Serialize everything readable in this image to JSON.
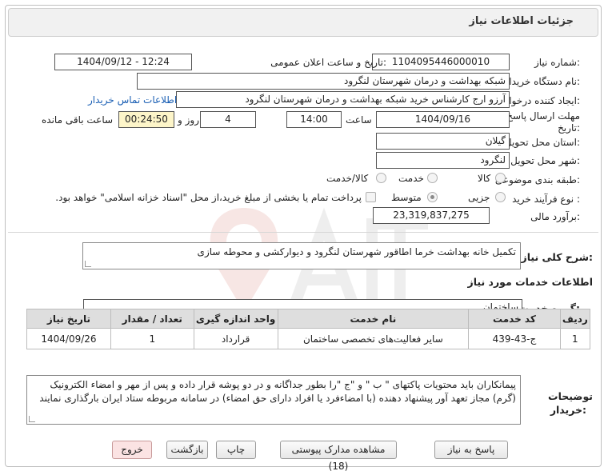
{
  "page": {
    "title": "جزئیات اطلاعات نیاز"
  },
  "form": {
    "need_number_label": "شماره نیاز:",
    "need_number": "1104095446000010",
    "announce_label": "تاریخ و ساعت اعلان عمومی:",
    "announce_value": "1404/09/12 - 12:24",
    "buyer_org_label": "نام دستگاه خریدار:",
    "buyer_org": "شبکه بهداشت و درمان شهرستان لنگرود",
    "creator_label": "ایجاد کننده درخواست:",
    "creator": "آرزو ارج کارشناس خرید شبکه بهداشت و درمان شهرستان لنگرود",
    "contact_link": "اطلاعات تماس خریدار",
    "deadline_label_1": "مهلت ارسال پاسخ: تا",
    "deadline_label_2": "تاریخ:",
    "deadline_date": "1404/09/16",
    "time_label": "ساعت",
    "deadline_time": "14:00",
    "days_value": "4",
    "days_label": "روز و",
    "remaining_time": "00:24:50",
    "remaining_label": "ساعت باقی مانده",
    "province_label": "استان محل تحویل:",
    "province": "گیلان",
    "city_label": "شهر محل تحویل:",
    "city": "لنگرود",
    "category_label": "طبقه بندی موضوعی:",
    "category_options": [
      "کالا",
      "خدمت",
      "کالا/خدمت"
    ],
    "category_selected": "خدمت",
    "process_label": "نوع فرآیند خرید :",
    "process_options": [
      "جزیی",
      "متوسط"
    ],
    "process_selected": "متوسط",
    "payment_note": "پرداخت تمام یا بخشی از مبلغ خرید،از محل \"اسناد خزانه اسلامی\" خواهد بود.",
    "estimate_label": "برآورد مالی:",
    "estimate": "23,319,837,275"
  },
  "summary": {
    "label": "شرح کلی نیاز:",
    "text": "تکمیل خانه بهداشت خرما اطاقور شهرستان لنگرود  و دیوارکشی و محوطه سازی"
  },
  "services": {
    "section_title": "اطلاعات خدمات مورد نیاز",
    "group_label": "گروه خدمت:",
    "group_value": "ساختمان",
    "columns": [
      "ردیف",
      "کد خدمت",
      "نام خدمت",
      "واحد اندازه گیری",
      "تعداد / مقدار",
      "تاریخ نیاز"
    ],
    "rows": [
      [
        "1",
        "ج-43-439",
        "سایر فعالیت‌های تخصصی ساختمان",
        "قرارداد",
        "1",
        "1404/09/26"
      ]
    ]
  },
  "buyer_notes": {
    "label_1": "توضیحات",
    "label_2": "خریدار:",
    "text": "پیمانکاران باید محتویات پاکتهای \" ب \" و \"ج \"را بطور  جداگانه  و در دو پوشه قرار داده  و پس از مهر و امضاء الکترونیک (گرم) مجاز تعهد آور پیشنهاد دهنده (با امضاءفرد یا افراد دارای حق امضاء) در سامانه مربوطه ستاد ایران بارگذاری نمایند"
  },
  "buttons": {
    "reply": "پاسخ به نیاز",
    "attachments": "مشاهده مدارک پیوستی (18)",
    "print": "چاپ",
    "back": "بازگشت",
    "exit": "خروج"
  },
  "colors": {
    "yellow_field": "#fdf5c9",
    "link": "#1a5fb4",
    "header_bg": "#dedede",
    "exit_button": "#fbe3e3"
  }
}
